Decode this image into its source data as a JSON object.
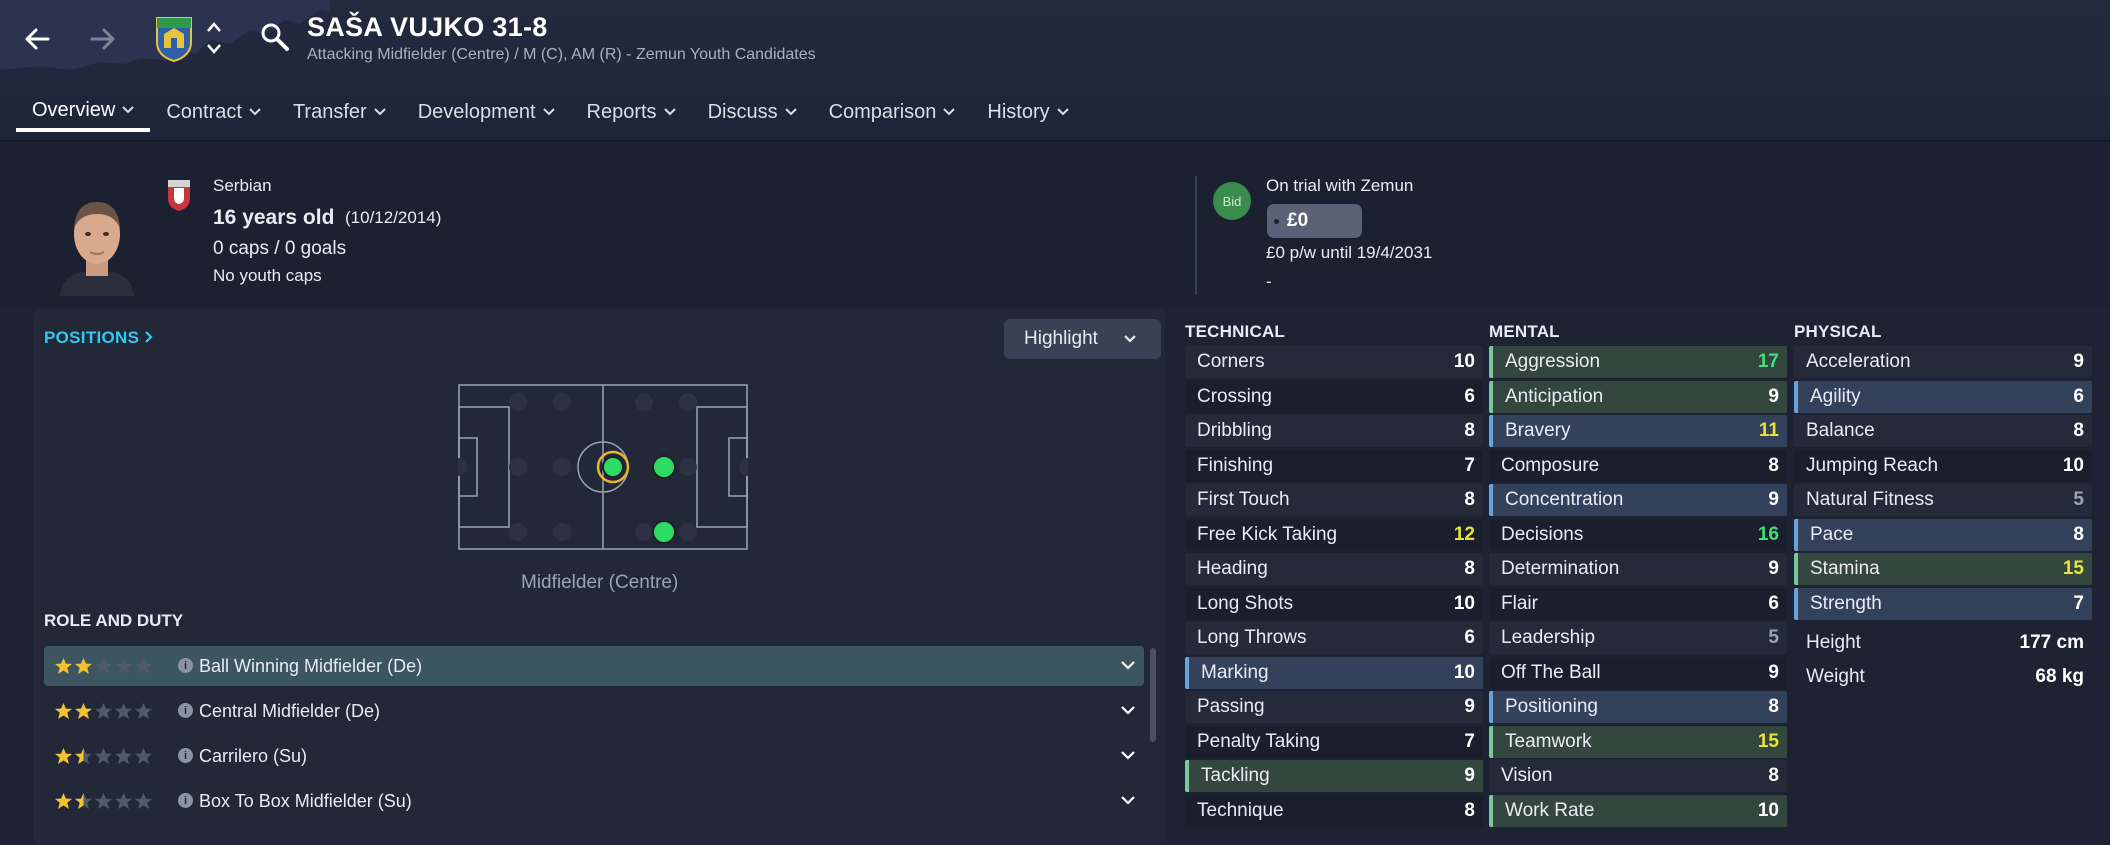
{
  "header": {
    "player_name": "SAŠA VUJKO 31-8",
    "subtitle": "Attacking Midfielder (Centre) / M (C), AM (R) - Zemun Youth Candidates",
    "tabs": [
      {
        "label": "Overview"
      },
      {
        "label": "Contract"
      },
      {
        "label": "Transfer"
      },
      {
        "label": "Development"
      },
      {
        "label": "Reports"
      },
      {
        "label": "Discuss"
      },
      {
        "label": "Comparison"
      },
      {
        "label": "History"
      }
    ]
  },
  "profile": {
    "nationality": "Serbian",
    "age": "16 years old",
    "dob": "(10/12/2014)",
    "caps": "0 caps / 0 goals",
    "youth_caps": "No youth caps"
  },
  "contract": {
    "bid_label": "Bid",
    "status": "On trial with Zemun",
    "fee": "£0",
    "wage": "£0 p/w until 19/4/2031",
    "extra": "-"
  },
  "positions": {
    "link": "POSITIONS",
    "highlight": "Highlight",
    "label": "Midfielder (Centre)"
  },
  "roles": {
    "heading": "ROLE AND DUTY",
    "items": [
      {
        "name": "Ball Winning Midfielder (De)",
        "stars": 2
      },
      {
        "name": "Central Midfielder (De)",
        "stars": 2
      },
      {
        "name": "Carrilero (Su)",
        "stars": 1.5
      },
      {
        "name": "Box To Box Midfielder (Su)",
        "stars": 1.5
      }
    ]
  },
  "technical": {
    "heading": "TECHNICAL",
    "rows": [
      {
        "name": "Corners",
        "value": "10"
      },
      {
        "name": "Crossing",
        "value": "6"
      },
      {
        "name": "Dribbling",
        "value": "8"
      },
      {
        "name": "Finishing",
        "value": "7"
      },
      {
        "name": "First Touch",
        "value": "8"
      },
      {
        "name": "Free Kick Taking",
        "value": "12"
      },
      {
        "name": "Heading",
        "value": "8"
      },
      {
        "name": "Long Shots",
        "value": "10"
      },
      {
        "name": "Long Throws",
        "value": "6"
      },
      {
        "name": "Marking",
        "value": "10"
      },
      {
        "name": "Passing",
        "value": "9"
      },
      {
        "name": "Penalty Taking",
        "value": "7"
      },
      {
        "name": "Tackling",
        "value": "9"
      },
      {
        "name": "Technique",
        "value": "8"
      }
    ]
  },
  "mental": {
    "heading": "MENTAL",
    "rows": [
      {
        "name": "Aggression",
        "value": "17"
      },
      {
        "name": "Anticipation",
        "value": "9"
      },
      {
        "name": "Bravery",
        "value": "11"
      },
      {
        "name": "Composure",
        "value": "8"
      },
      {
        "name": "Concentration",
        "value": "9"
      },
      {
        "name": "Decisions",
        "value": "16"
      },
      {
        "name": "Determination",
        "value": "9"
      },
      {
        "name": "Flair",
        "value": "6"
      },
      {
        "name": "Leadership",
        "value": "5"
      },
      {
        "name": "Off The Ball",
        "value": "9"
      },
      {
        "name": "Positioning",
        "value": "8"
      },
      {
        "name": "Teamwork",
        "value": "15"
      },
      {
        "name": "Vision",
        "value": "8"
      },
      {
        "name": "Work Rate",
        "value": "10"
      }
    ]
  },
  "physical": {
    "heading": "PHYSICAL",
    "rows": [
      {
        "name": "Acceleration",
        "value": "9"
      },
      {
        "name": "Agility",
        "value": "6"
      },
      {
        "name": "Balance",
        "value": "8"
      },
      {
        "name": "Jumping Reach",
        "value": "10"
      },
      {
        "name": "Natural Fitness",
        "value": "5"
      },
      {
        "name": "Pace",
        "value": "8"
      },
      {
        "name": "Stamina",
        "value": "15"
      },
      {
        "name": "Strength",
        "value": "7"
      }
    ],
    "height_label": "Height",
    "height": "177 cm",
    "weight_label": "Weight",
    "weight": "68 kg"
  },
  "colors": {
    "accent": "#32c8ef",
    "good": "#3de07a",
    "mid": "#e6e33a",
    "low": "#9aa2b4",
    "highlight_blue": "#6aa3dc",
    "highlight_green": "#7bc69a"
  }
}
